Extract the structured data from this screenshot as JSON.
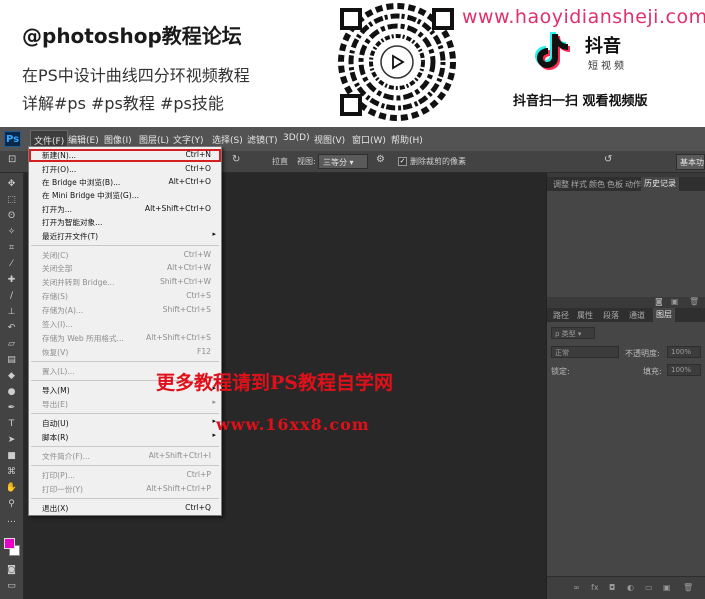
{
  "banner": {
    "title": "@photoshop教程论坛",
    "line1": "在PS中设计曲线四分环视频教程",
    "line2": "详解#ps #ps教程 #ps技能",
    "url": "www.haoyidiansheji.com",
    "tiktok_name": "抖音",
    "tiktok_sub": "短视频",
    "tiktok_cta": "抖音扫一扫 观看视频版",
    "accent_color": "#e0306a"
  },
  "menubar": {
    "logo": "Ps",
    "items": [
      {
        "label": "文件(F)"
      },
      {
        "label": "编辑(E)"
      },
      {
        "label": "图像(I)"
      },
      {
        "label": "图层(L)"
      },
      {
        "label": "文字(Y)"
      },
      {
        "label": "选择(S)"
      },
      {
        "label": "滤镜(T)"
      },
      {
        "label": "3D(D)"
      },
      {
        "label": "视图(V)"
      },
      {
        "label": "窗口(W)"
      },
      {
        "label": "帮助(H)"
      }
    ]
  },
  "optionsbar": {
    "straighten": "拉直",
    "view_label": "视图:",
    "view_value": "三等分",
    "delete_cropped": "删除裁剪的像素",
    "workspace": "基本功"
  },
  "file_menu": {
    "items": [
      {
        "label": "新建(N)...",
        "shortcut": "Ctrl+N",
        "disabled": false,
        "submenu": false
      },
      {
        "label": "打开(O)...",
        "shortcut": "Ctrl+O",
        "disabled": false,
        "submenu": false
      },
      {
        "label": "在 Bridge 中浏览(B)...",
        "shortcut": "Alt+Ctrl+O",
        "disabled": false,
        "submenu": false
      },
      {
        "label": "在 Mini Bridge 中浏览(G)...",
        "shortcut": "",
        "disabled": false,
        "submenu": false
      },
      {
        "label": "打开为...",
        "shortcut": "Alt+Shift+Ctrl+O",
        "disabled": false,
        "submenu": false
      },
      {
        "label": "打开为智能对象...",
        "shortcut": "",
        "disabled": false,
        "submenu": false
      },
      {
        "label": "最近打开文件(T)",
        "shortcut": "",
        "disabled": false,
        "submenu": true
      },
      {
        "label": "关闭(C)",
        "shortcut": "Ctrl+W",
        "disabled": true,
        "submenu": false
      },
      {
        "label": "关闭全部",
        "shortcut": "Alt+Ctrl+W",
        "disabled": true,
        "submenu": false
      },
      {
        "label": "关闭并转到 Bridge...",
        "shortcut": "Shift+Ctrl+W",
        "disabled": true,
        "submenu": false
      },
      {
        "label": "存储(S)",
        "shortcut": "Ctrl+S",
        "disabled": true,
        "submenu": false
      },
      {
        "label": "存储为(A)...",
        "shortcut": "Shift+Ctrl+S",
        "disabled": true,
        "submenu": false
      },
      {
        "label": "签入(I)...",
        "shortcut": "",
        "disabled": true,
        "submenu": false
      },
      {
        "label": "存储为 Web 所用格式...",
        "shortcut": "Alt+Shift+Ctrl+S",
        "disabled": true,
        "submenu": false
      },
      {
        "label": "恢复(V)",
        "shortcut": "F12",
        "disabled": true,
        "submenu": false
      },
      {
        "label": "置入(L)...",
        "shortcut": "",
        "disabled": true,
        "submenu": false
      },
      {
        "label": "导入(M)",
        "shortcut": "",
        "disabled": false,
        "submenu": true
      },
      {
        "label": "导出(E)",
        "shortcut": "",
        "disabled": true,
        "submenu": true
      },
      {
        "label": "自动(U)",
        "shortcut": "",
        "disabled": false,
        "submenu": true
      },
      {
        "label": "脚本(R)",
        "shortcut": "",
        "disabled": false,
        "submenu": true
      },
      {
        "label": "文件简介(F)...",
        "shortcut": "Alt+Shift+Ctrl+I",
        "disabled": true,
        "submenu": false
      },
      {
        "label": "打印(P)...",
        "shortcut": "Ctrl+P",
        "disabled": true,
        "submenu": false
      },
      {
        "label": "打印一份(Y)",
        "shortcut": "Alt+Shift+Ctrl+P",
        "disabled": true,
        "submenu": false
      },
      {
        "label": "退出(X)",
        "shortcut": "Ctrl+Q",
        "disabled": false,
        "submenu": false
      }
    ]
  },
  "panels": {
    "top_tabs": [
      "调整",
      "样式",
      "颜色",
      "色板",
      "动作",
      "历史记录"
    ],
    "active_top_tab": "历史记录",
    "layer_tabs": [
      "路径",
      "属性",
      "段落",
      "通道",
      "图层"
    ],
    "active_layer_tab": "图层",
    "filter_label": "类型",
    "blend_mode": "正常",
    "opacity_label": "不透明度:",
    "opacity_value": "100%",
    "lock_label": "锁定:",
    "fill_label": "填充:",
    "fill_value": "100%"
  },
  "watermark": {
    "line1": "更多教程请到PS教程自学网",
    "line2": "www.16xx8.com",
    "color": "#e0101a"
  }
}
